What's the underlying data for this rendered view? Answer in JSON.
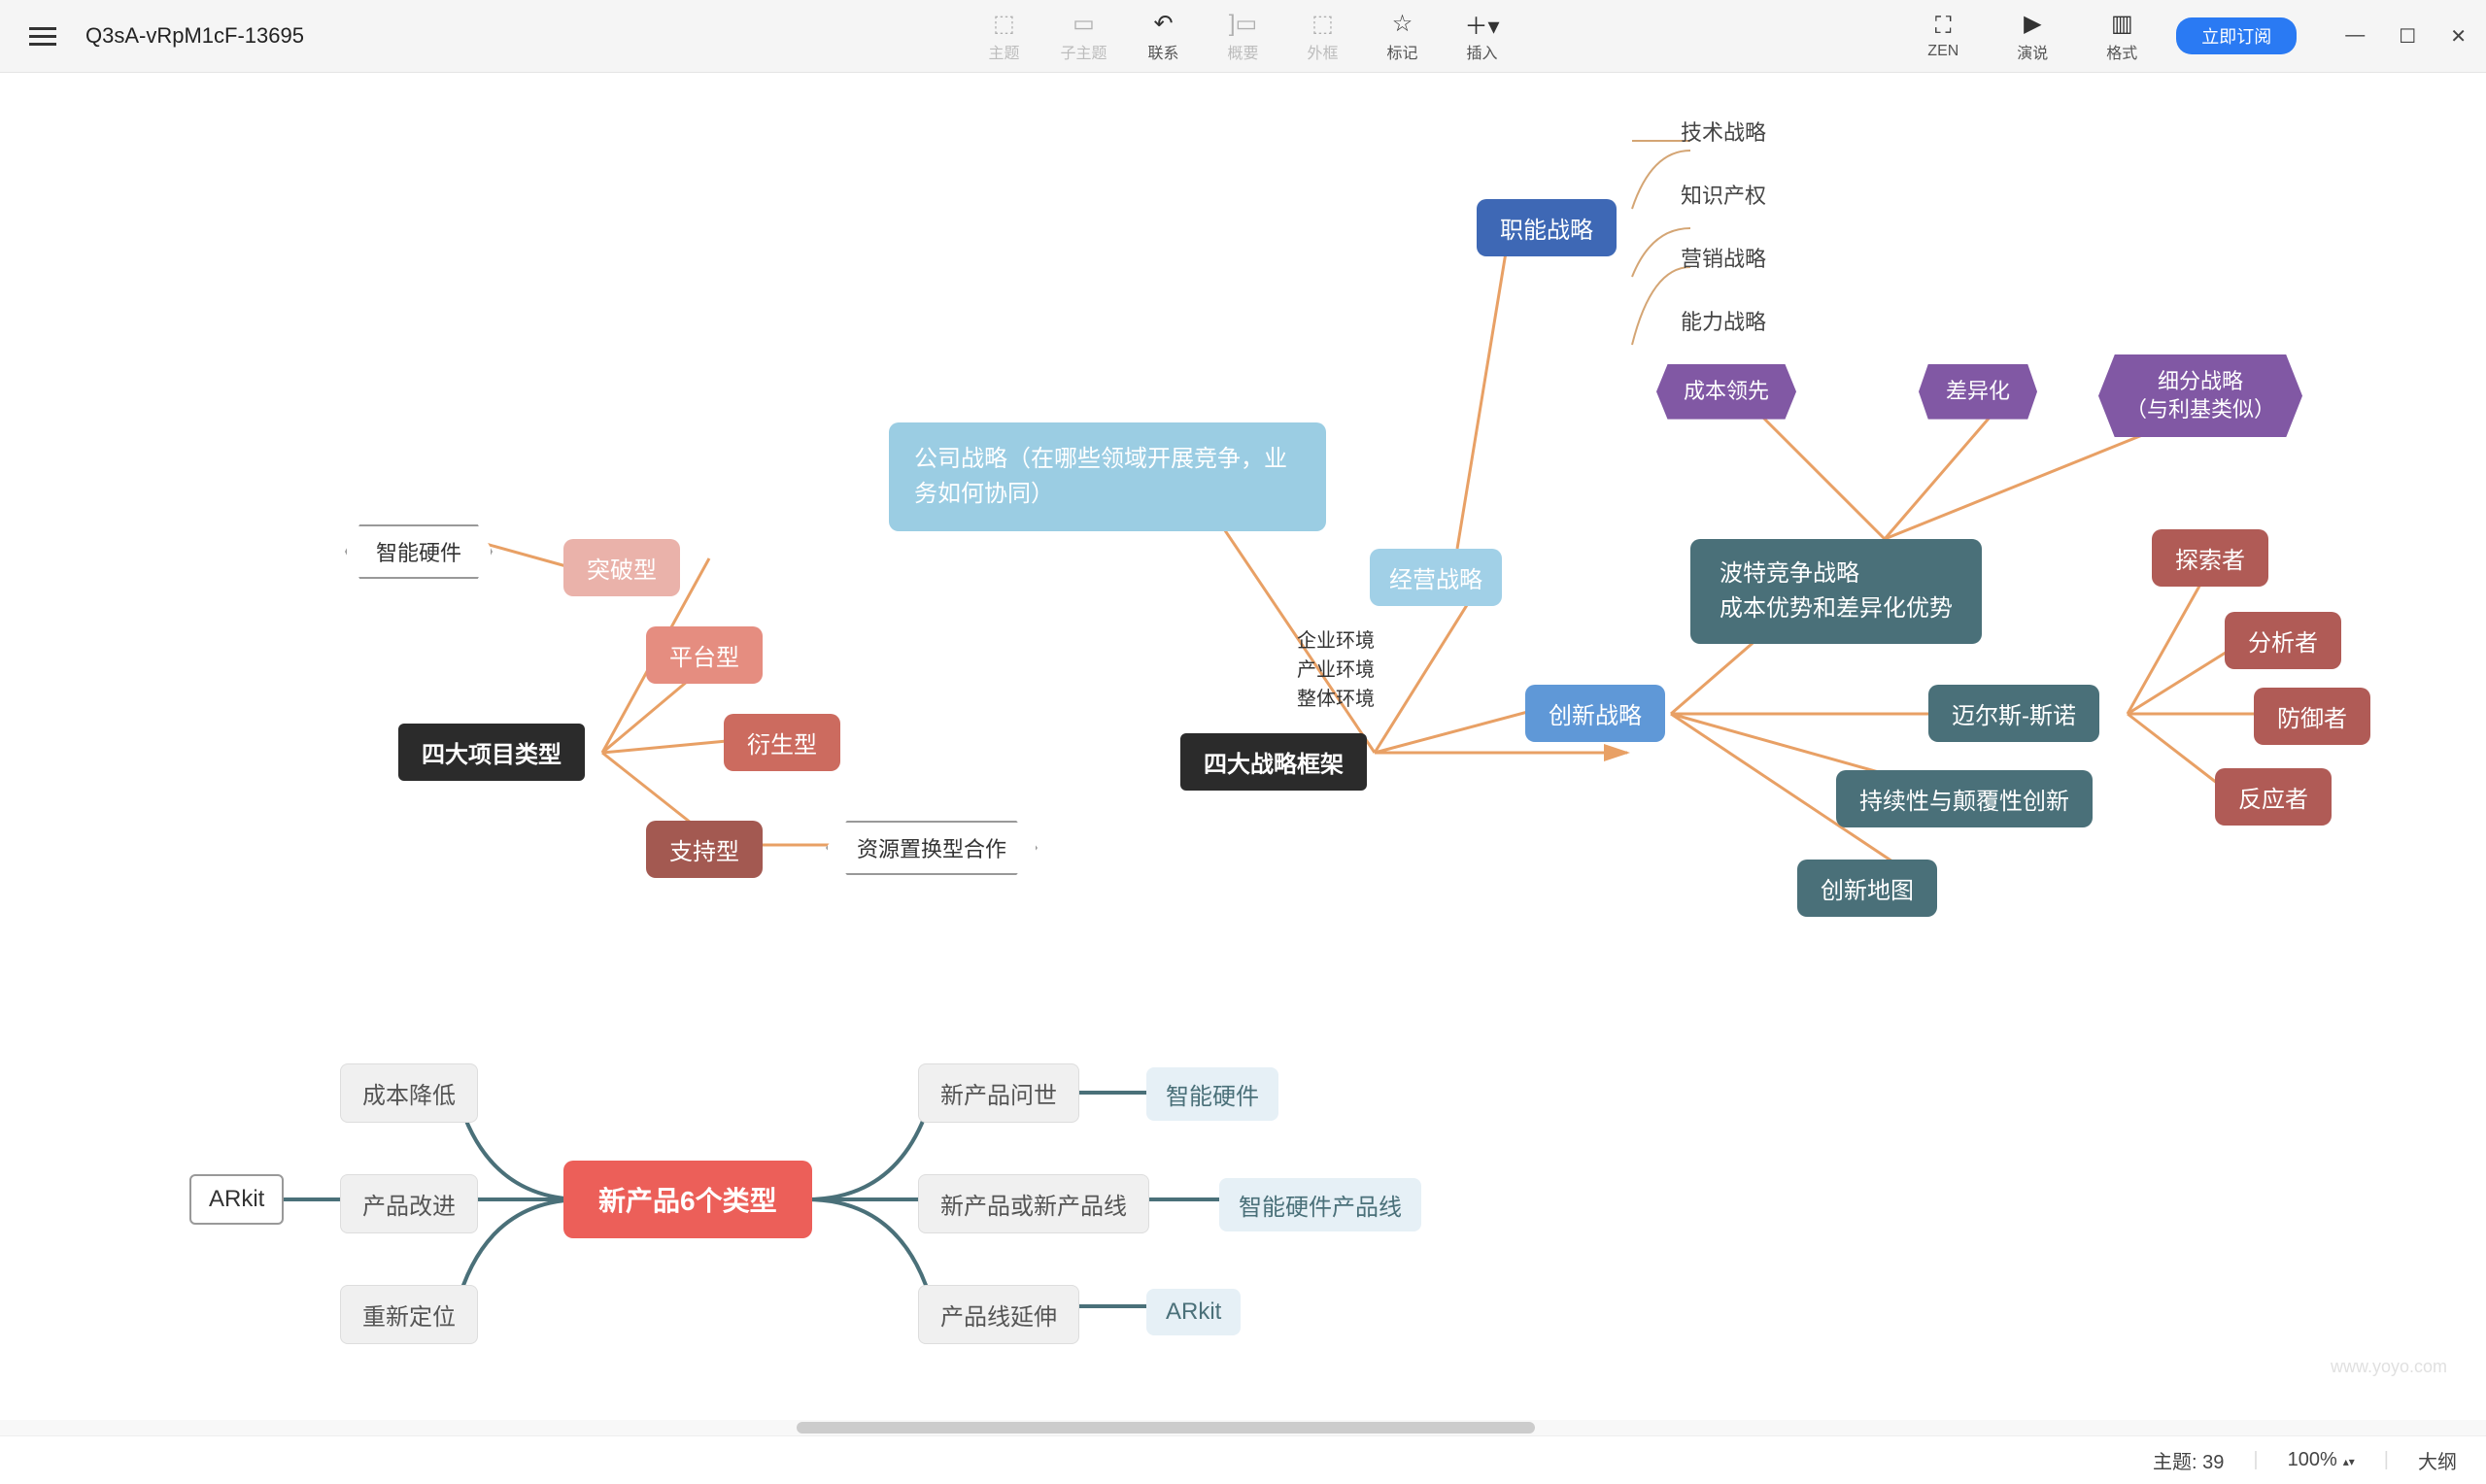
{
  "doc_title": "Q3sA-vRpM1cF-13695",
  "toolbar": {
    "items": [
      {
        "label": "主题",
        "disabled": true
      },
      {
        "label": "子主题",
        "disabled": true
      },
      {
        "label": "联系",
        "disabled": false
      },
      {
        "label": "概要",
        "disabled": true
      },
      {
        "label": "外框",
        "disabled": true
      },
      {
        "label": "标记",
        "disabled": false
      },
      {
        "label": "插入",
        "disabled": false
      }
    ],
    "right": [
      {
        "label": "ZEN"
      },
      {
        "label": "演说"
      },
      {
        "label": "格式"
      }
    ],
    "subscribe": "立即订阅"
  },
  "mindmap": {
    "root1": "四大项目类型",
    "root1_children": [
      "突破型",
      "平台型",
      "衍生型",
      "支持型"
    ],
    "root1_callouts": [
      "智能硬件",
      "资源置换型合作"
    ],
    "root2": "四大战略框架",
    "root2_company": "公司战略（在哪些领域开展竞争，业务如何协同）",
    "root2_business": "经营战略",
    "root2_env": [
      "企业环境",
      "产业环境",
      "整体环境"
    ],
    "functional": "职能战略",
    "functional_children": [
      "技术战略",
      "知识产权",
      "营销战略",
      "能力战略"
    ],
    "porter": "波特竞争战略\n成本优势和差异化优势",
    "porter_children": [
      "成本领先",
      "差异化",
      "细分战略\n（与利基类似）"
    ],
    "innovation": "创新战略",
    "miles": "迈尔斯-斯诺",
    "miles_children": [
      "探索者",
      "分析者",
      "防御者",
      "反应者"
    ],
    "sustain": "持续性与颠覆性创新",
    "inno_map": "创新地图",
    "root3": "新产品6个类型",
    "root3_left": [
      "成本降低",
      "产品改进",
      "重新定位"
    ],
    "root3_right": [
      "新产品问世",
      "新产品或新产品线",
      "产品线延伸"
    ],
    "root3_tags": [
      "智能硬件",
      "智能硬件产品线",
      "ARkit"
    ],
    "root3_left_tag": "ARkit"
  },
  "status": {
    "topic_label": "主题:",
    "topic_count": "39",
    "zoom": "100%",
    "outline": "大纲"
  },
  "watermark": "www.yoyo.com"
}
